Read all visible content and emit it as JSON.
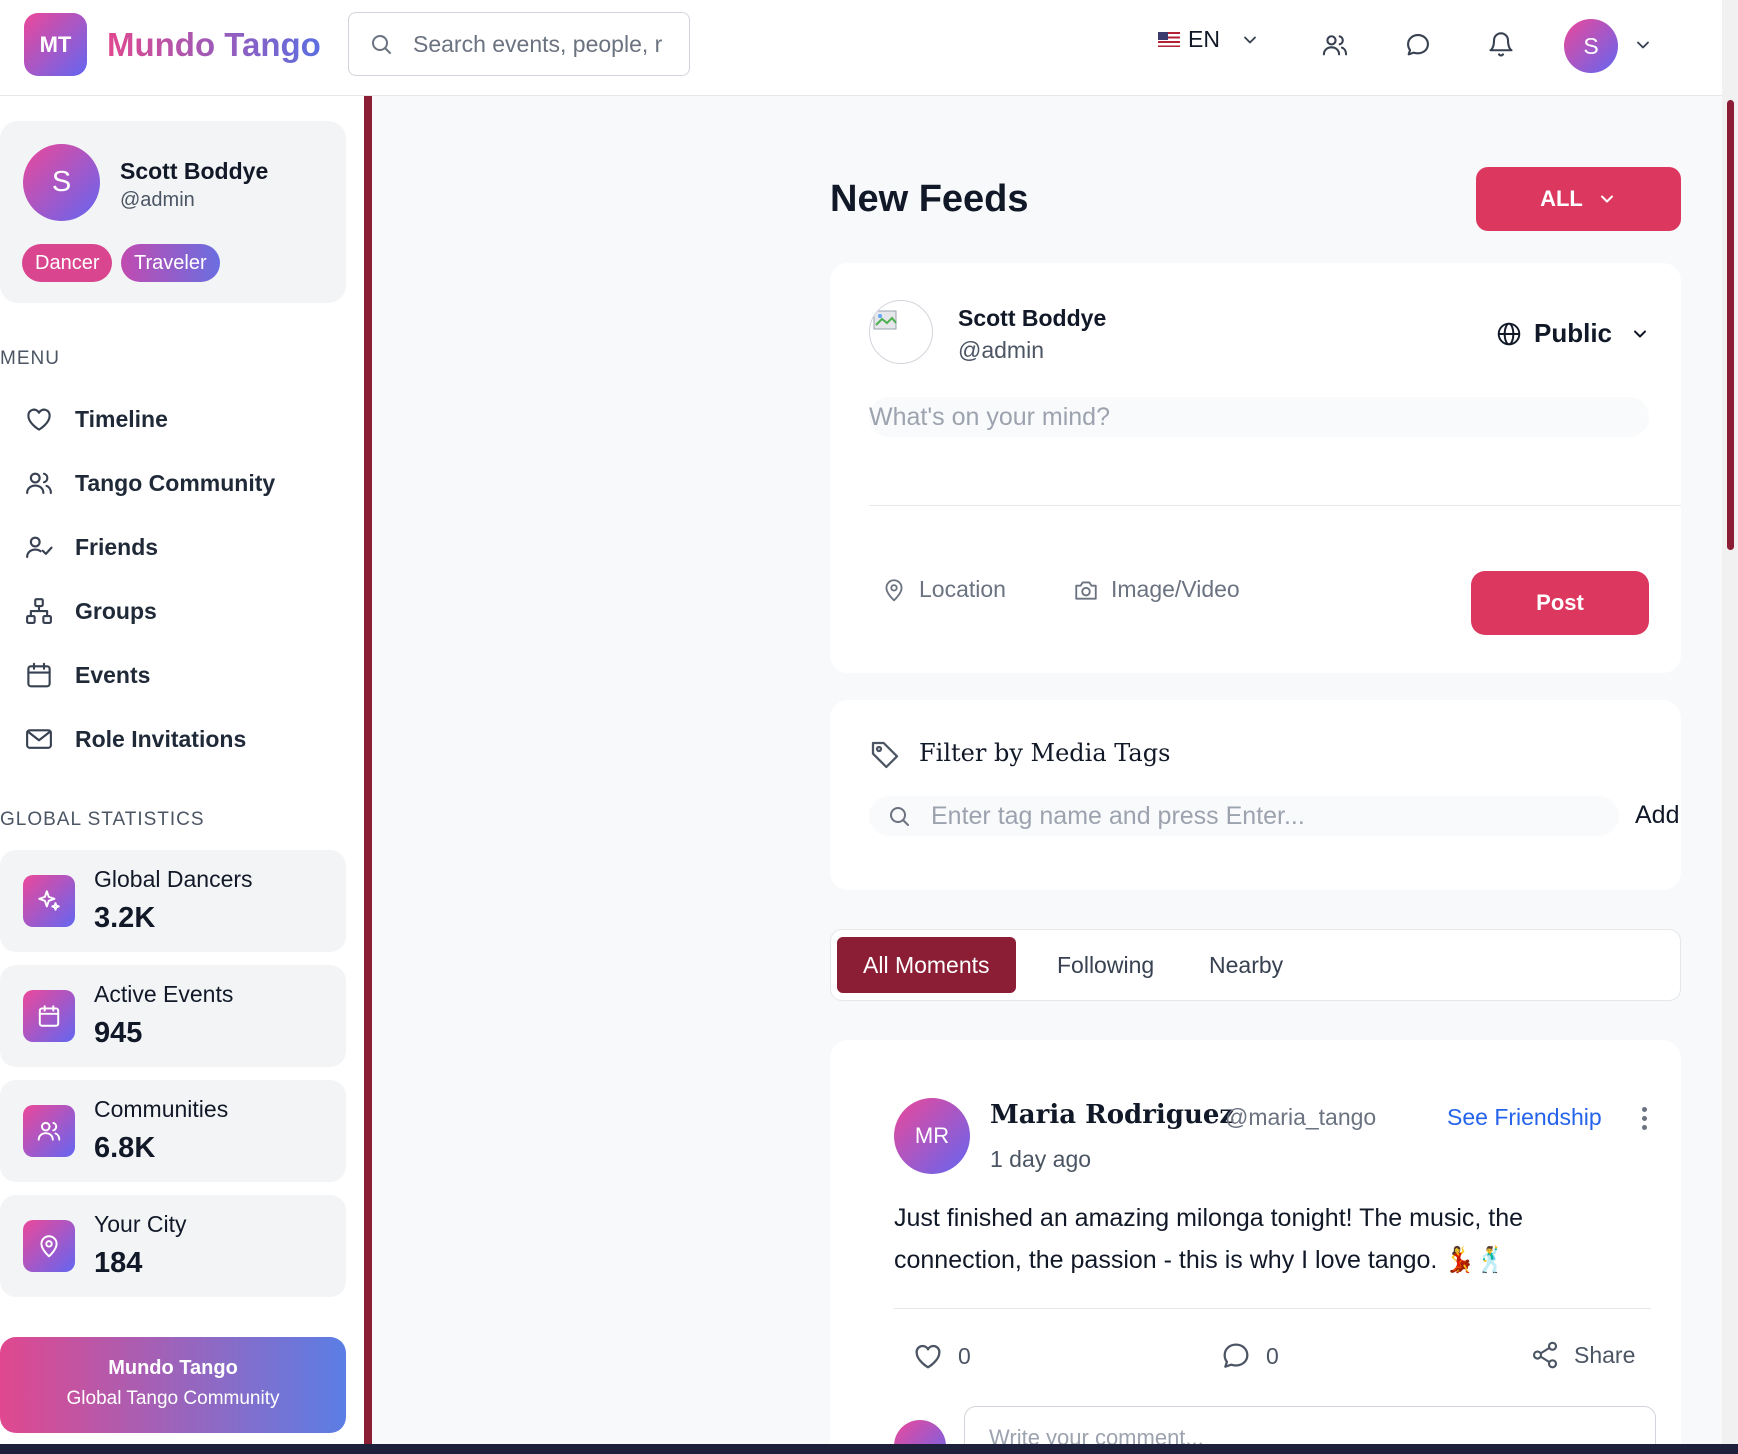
{
  "header": {
    "logo_initials": "MT",
    "app_name": "Mundo Tango",
    "search_placeholder": "Search events, people, r",
    "language": "EN",
    "avatar_initial": "S"
  },
  "sidebar": {
    "profile": {
      "initial": "S",
      "name": "Scott Boddye",
      "handle": "@admin",
      "tags": [
        "Dancer",
        "Traveler"
      ]
    },
    "menu_label": "MENU",
    "menu": [
      {
        "label": "Timeline",
        "icon": "heart-icon"
      },
      {
        "label": "Tango Community",
        "icon": "users-icon"
      },
      {
        "label": "Friends",
        "icon": "user-check-icon"
      },
      {
        "label": "Groups",
        "icon": "network-icon"
      },
      {
        "label": "Events",
        "icon": "calendar-icon"
      },
      {
        "label": "Role Invitations",
        "icon": "mail-icon"
      }
    ],
    "stats_label": "GLOBAL STATISTICS",
    "stats": [
      {
        "label": "Global Dancers",
        "value": "3.2K",
        "icon": "sparkles-icon"
      },
      {
        "label": "Active Events",
        "value": "945",
        "icon": "calendar-icon"
      },
      {
        "label": "Communities",
        "value": "6.8K",
        "icon": "users-icon"
      },
      {
        "label": "Your City",
        "value": "184",
        "icon": "map-pin-icon"
      }
    ],
    "brand": {
      "title": "Mundo Tango",
      "subtitle": "Global Tango Community"
    }
  },
  "main": {
    "title": "New Feeds",
    "filter_button": "ALL",
    "composer": {
      "name": "Scott Boddye",
      "handle": "@admin",
      "privacy": "Public",
      "placeholder": "What's on your mind?",
      "location_label": "Location",
      "media_label": "Image/Video",
      "post_label": "Post"
    },
    "tag_filter": {
      "title": "Filter by Media Tags",
      "placeholder": "Enter tag name and press Enter...",
      "add_label": "Add"
    },
    "tabs": [
      "All Moments",
      "Following",
      "Nearby"
    ],
    "active_tab": "All Moments",
    "post": {
      "initials": "MR",
      "author": "Maria Rodriguez",
      "handle": "@maria_tango",
      "time": "1 day ago",
      "friendship_link": "See Friendship",
      "text": "Just finished an amazing milonga tonight! The music, the connection, the passion - this is why I love tango. 💃🕺",
      "likes": "0",
      "comments": "0",
      "share_label": "Share",
      "comment_placeholder": "Write your comment..."
    }
  },
  "colors": {
    "accent": "#dc385f",
    "sidebar_border": "#8b1d35",
    "active_tab": "#8b1d35",
    "link": "#2563eb",
    "gradient_start": "#ec4899",
    "gradient_end": "#6366f1"
  }
}
